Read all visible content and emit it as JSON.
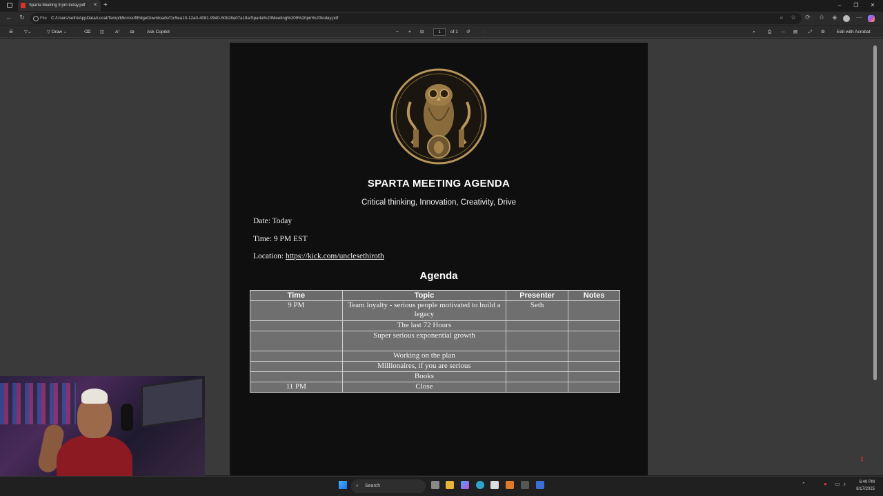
{
  "browser": {
    "tab_title": "Sparta Meeting 9 pm today.pdf",
    "url_label": "File",
    "url": "C:/Users/sethi/AppData/Local/Temp/MicrosoftEdgeDownloads/f1c5ea10-12a0-4081-9940-50b28a07a18a/Sparta%20Meeting%209%20pm%20today.pdf"
  },
  "pdf_toolbar": {
    "draw_label": "Draw",
    "ask_copilot_label": "Ask Copilot",
    "page_current": "1",
    "page_total": "of 1",
    "edit_acrobat_label": "Edit with Acrobat"
  },
  "document": {
    "title": "SPARTA MEETING AGENDA",
    "subtitle": "Critical thinking, Innovation, Creativity, Drive",
    "date": "Date: Today",
    "time": "Time: 9 PM EST",
    "location_label": "Location: ",
    "location_link": "https://kick.com/unclesethiroth",
    "agenda_heading": "Agenda",
    "table": {
      "headers": [
        "Time",
        "Topic",
        "Presenter",
        "Notes"
      ],
      "rows": [
        [
          "9 PM",
          "Team loyalty - serious people motivated to build a legacy",
          "Seth",
          ""
        ],
        [
          "",
          "The last 72 Hours",
          "",
          ""
        ],
        [
          "",
          "Super serious exponential growth",
          "",
          ""
        ],
        [
          "",
          "Working on the plan",
          "",
          ""
        ],
        [
          "",
          "Millionaires, if you are serious",
          "",
          ""
        ],
        [
          "",
          "Books",
          "",
          ""
        ],
        [
          "11 PM",
          "Close",
          "",
          ""
        ]
      ]
    }
  },
  "taskbar": {
    "search_placeholder": "Search",
    "time": "6:40 PM",
    "date": "8/17/2025"
  },
  "colors": {
    "accent_gold": "#b8955a",
    "doc_bg": "#0f0f0f",
    "table_bg": "#6f6f6f"
  }
}
